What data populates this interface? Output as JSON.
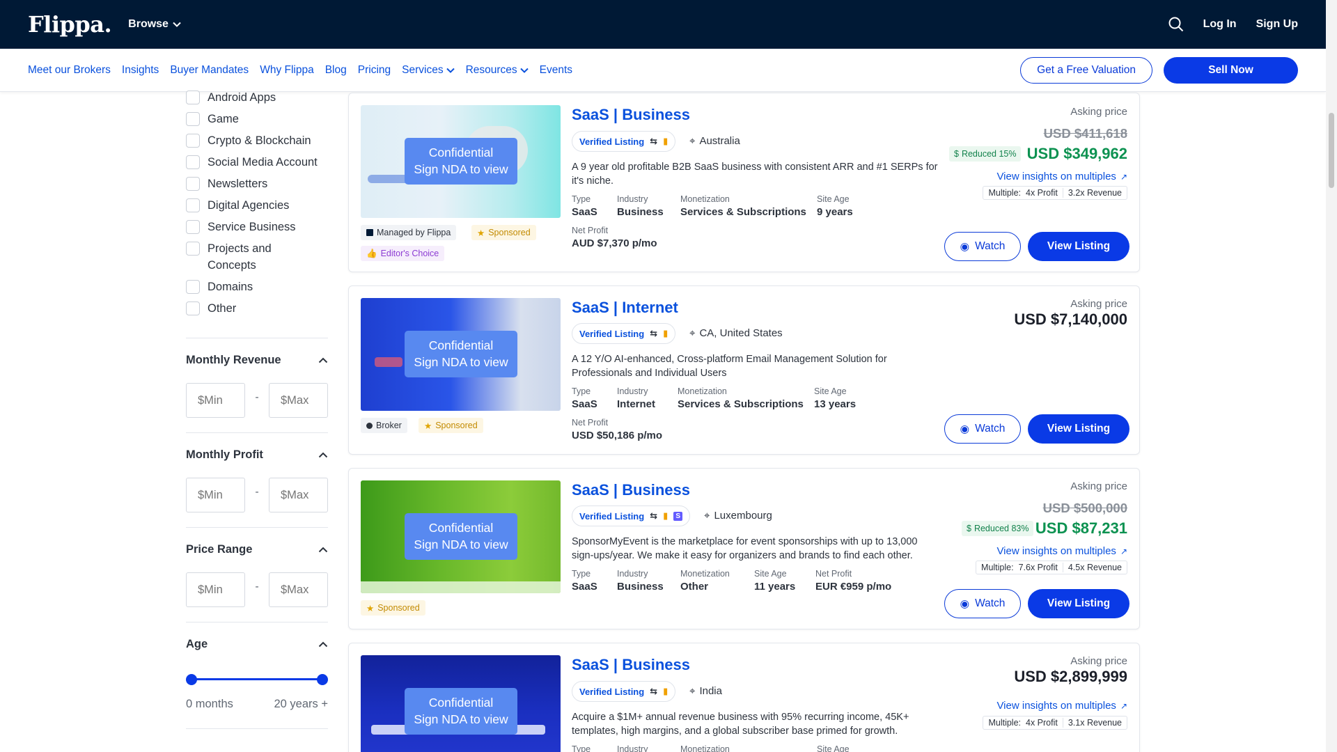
{
  "header": {
    "logo": "Flippa.",
    "browse": "Browse",
    "login": "Log In",
    "signup": "Sign Up"
  },
  "subnav": {
    "links": [
      "Meet our Brokers",
      "Insights",
      "Buyer Mandates",
      "Why Flippa",
      "Blog",
      "Pricing",
      "Services",
      "Resources",
      "Events"
    ],
    "valuation": "Get a Free Valuation",
    "sell": "Sell Now"
  },
  "sidebar": {
    "categories": [
      "Android Apps",
      "Game",
      "Crypto & Blockchain",
      "Social Media Account",
      "Newsletters",
      "Digital Agencies",
      "Service Business",
      "Projects and Concepts",
      "Domains",
      "Other"
    ],
    "revenue": {
      "title": "Monthly Revenue",
      "min": "$Min",
      "max": "$Max",
      "dash": "-"
    },
    "profit": {
      "title": "Monthly Profit",
      "min": "$Min",
      "max": "$Max",
      "dash": "-"
    },
    "price": {
      "title": "Price Range",
      "min": "$Min",
      "max": "$Max",
      "dash": "-"
    },
    "age": {
      "title": "Age",
      "min_label": "0 months",
      "max_label": "20 years +"
    }
  },
  "common": {
    "confidential": "Confidential",
    "nda": "Sign NDA to view",
    "verified": "Verified Listing",
    "asking": "Asking price",
    "insights": "View insights on multiples",
    "watch": "Watch",
    "view": "View Listing",
    "multiple_label": "Multiple:",
    "k_type": "Type",
    "k_industry": "Industry",
    "k_monetization": "Monetization",
    "k_age": "Site Age",
    "k_profit": "Net Profit"
  },
  "listings": [
    {
      "title": "SaaS | Business",
      "location": "Australia",
      "description": "A 9 year old profitable B2B SaaS business with consistent ARR and #1 SERPs for it's niche.",
      "type": "SaaS",
      "industry": "Business",
      "monetization": "Services & Subscriptions",
      "age": "9 years",
      "profit": "AUD $7,370 p/mo",
      "old_price": "USD $411,618",
      "reduced": "Reduced 15%",
      "price": "USD $349,962",
      "mult_profit": "4x Profit",
      "mult_revenue": "3.2x Revenue",
      "badges": [
        "Managed by Flippa",
        "Sponsored",
        "Editor's Choice"
      ]
    },
    {
      "title": "SaaS | Internet",
      "location": "CA, United States",
      "description": "A 12 Y/O AI-enhanced, Cross-platform Email Management Solution for Professionals and Individual Users",
      "type": "SaaS",
      "industry": "Internet",
      "monetization": "Services & Subscriptions",
      "age": "13 years",
      "profit": "USD $50,186 p/mo",
      "price": "USD $7,140,000",
      "badges": [
        "Broker",
        "Sponsored"
      ]
    },
    {
      "title": "SaaS | Business",
      "location": "Luxembourg",
      "description": "SponsorMyEvent is the marketplace for event sponsorships with up to 13,000 sign-ups/year. We make it easy for organizers and brands to find each other.",
      "type": "SaaS",
      "industry": "Business",
      "monetization": "Other",
      "age": "11 years",
      "profit": "EUR €959 p/mo",
      "old_price": "USD $500,000",
      "reduced": "Reduced 83%",
      "price": "USD $87,231",
      "mult_profit": "7.6x Profit",
      "mult_revenue": "4.5x Revenue",
      "badges": [
        "Sponsored"
      ]
    },
    {
      "title": "SaaS | Business",
      "location": "India",
      "description": "Acquire a $1M+ annual revenue business with 95% recurring income, 45K+ templates, high margins, and a global subscriber base primed for growth.",
      "price": "USD $2,899,999",
      "mult_profit": "4x Profit",
      "mult_revenue": "3.1x Revenue"
    }
  ],
  "colors": {
    "nav_bg": "#001935",
    "brand_blue": "#0a3ae6",
    "link_blue": "#0a51dd",
    "reduced_green": "#0d9251"
  }
}
